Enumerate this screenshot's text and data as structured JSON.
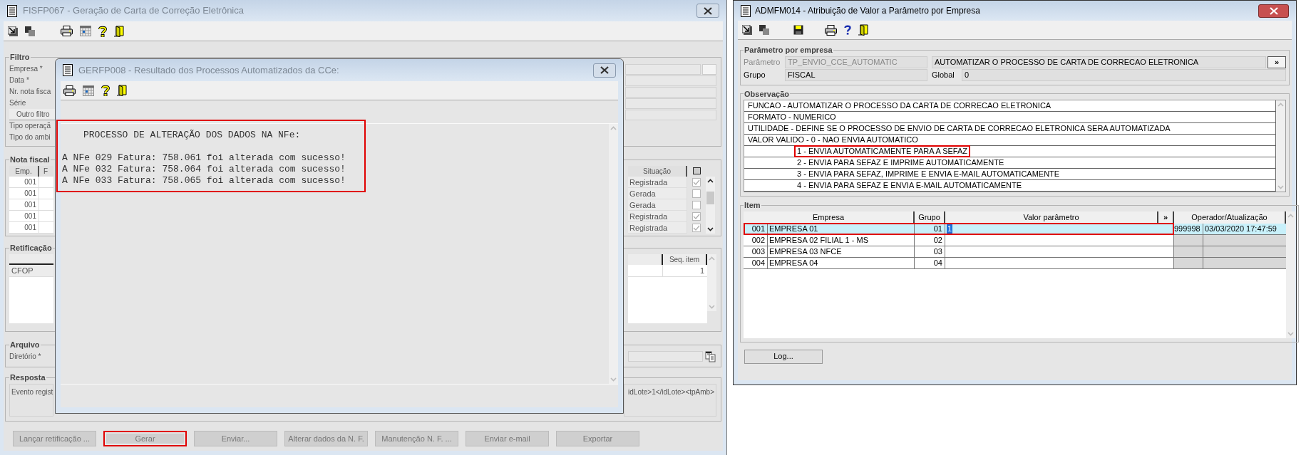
{
  "left_window": {
    "title": "FISFP067 - Geração de Carta de Correção Eletrônica",
    "filtro": {
      "title": "Filtro",
      "items": [
        {
          "kind": "label",
          "text": "Empresa *"
        },
        {
          "kind": "label",
          "text": "Data *"
        },
        {
          "kind": "label",
          "text": "Nr. nota fisca"
        },
        {
          "kind": "label",
          "text": "Série"
        },
        {
          "kind": "button",
          "text": "Outro filtro"
        },
        {
          "kind": "label",
          "text": "Tipo operaçã"
        },
        {
          "kind": "label",
          "text": "Tipo do ambi"
        }
      ]
    },
    "nota_fiscal": {
      "title": "Nota fiscal",
      "columns": [
        "Emp.",
        "F"
      ],
      "status_column": "Situação",
      "rows": [
        {
          "empresa": "001",
          "situacao": "Registrada",
          "checked": true
        },
        {
          "empresa": "001",
          "situacao": "Gerada",
          "checked": false
        },
        {
          "empresa": "001",
          "situacao": "Gerada",
          "checked": false
        },
        {
          "empresa": "001",
          "situacao": "Registrada",
          "checked": true
        },
        {
          "empresa": "001",
          "situacao": "Registrada",
          "checked": true
        }
      ]
    },
    "retificacao": {
      "title": "Retificação",
      "rows": [
        "CFOP"
      ],
      "seq_column": "Seq. item",
      "seq_values": [
        "1"
      ]
    },
    "arquivo": {
      "title": "Arquivo",
      "label": "Diretório *"
    },
    "resposta": {
      "title": "Resposta",
      "text_start": "Evento regist",
      "text_end": "idLote>1</idLote><tpAmb>"
    },
    "buttons": [
      {
        "label": "Lançar retificação ...",
        "disabled": true,
        "highlighted": false
      },
      {
        "label": "Gerar",
        "disabled": true,
        "highlighted": true
      },
      {
        "label": "Enviar...",
        "disabled": true,
        "highlighted": false
      },
      {
        "label": "Alterar dados da N. F.",
        "disabled": true,
        "highlighted": false
      },
      {
        "label": "Manutenção N. F. ...",
        "disabled": true,
        "highlighted": false
      },
      {
        "label": "Enviar e-mail",
        "disabled": true,
        "highlighted": false
      },
      {
        "label": "Exportar",
        "disabled": true,
        "highlighted": false
      }
    ]
  },
  "dialog": {
    "title": "GERFP008 - Resultado dos Processos Automatizados da CCe:",
    "heading": "PROCESSO DE ALTERAÇÃO DOS DADOS NA NFe:",
    "highlighted": true,
    "lines": [
      "A NFe 029 Fatura: 758.061 foi alterada com sucesso!",
      "A NFe 032 Fatura: 758.064 foi alterada com sucesso!",
      "A NFe 033 Fatura: 758.065 foi alterada com sucesso!"
    ]
  },
  "right_window": {
    "title": "ADMFM014 - Atribuição de Valor a Parâmetro por Empresa",
    "parametro_group": {
      "title": "Parâmetro por empresa",
      "parametro": {
        "label": "Parâmetro",
        "value": "TP_ENVIO_CCE_AUTOMATIC",
        "disabled": true
      },
      "descricao": "AUTOMATIZAR O PROCESSO DE CARTA DE CORRECAO ELETRONICA",
      "more_button": "»",
      "grupo": {
        "label": "Grupo",
        "value": "FISCAL",
        "disabled": false
      },
      "global": {
        "label": "Global",
        "value": "0"
      }
    },
    "observacao": {
      "title": "Observação",
      "lines": [
        {
          "text": "FUNCAO -  AUTOMATIZAR O PROCESSO DA CARTA DE CORRECAO ELETRONICA",
          "highlighted": false
        },
        {
          "text": "FORMATO - NUMERICO",
          "highlighted": false
        },
        {
          "text": "UTILIDADE - DEFINE SE O PROCESSO DE ENVIO DE CARTA DE CORRECAO ELETRONICA SERA AUTOMATIZADA",
          "highlighted": false
        },
        {
          "text": "VALOR VALIDO - 0 - NAO ENVIA AUTOMATICO",
          "highlighted": false,
          "children": [
            {
              "text": "1 - ENVIA AUTOMATICAMENTE PARA A SEFAZ",
              "highlighted": true
            },
            {
              "text": "2 - ENVIA PARA SEFAZ E IMPRIME AUTOMATICAMENTE",
              "highlighted": false
            },
            {
              "text": "3 - ENVIA PARA SEFAZ, IMPRIME E ENVIA E-MAIL AUTOMATICAMENTE",
              "highlighted": false
            },
            {
              "text": "4 - ENVIA PARA SEFAZ E ENVIA E-MAIL AUTOMATICAMENTE",
              "highlighted": false
            }
          ]
        }
      ]
    },
    "item": {
      "title": "Item",
      "columns": [
        "Empresa",
        "Grupo",
        "Valor parâmetro",
        "»",
        "Operador/Atualização"
      ],
      "rows": [
        {
          "codigo": "001",
          "empresa": "EMPRESA 01",
          "grupo": "01",
          "valor": "1",
          "operador": "999998",
          "atualizacao": "03/03/2020 17:47:59",
          "selected": true,
          "highlighted": true
        },
        {
          "codigo": "002",
          "empresa": "EMPRESA 02 FILIAL 1 - MS",
          "grupo": "02",
          "selected": false,
          "highlighted": false
        },
        {
          "codigo": "003",
          "empresa": "EMPRESA 03 NFCE",
          "grupo": "03",
          "selected": false,
          "highlighted": false
        },
        {
          "codigo": "004",
          "empresa": "EMPRESA 04",
          "grupo": "04",
          "selected": false,
          "highlighted": false
        }
      ]
    },
    "log_button": "Log..."
  }
}
